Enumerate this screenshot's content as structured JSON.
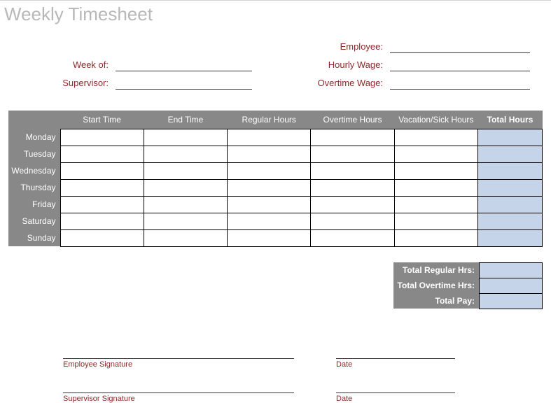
{
  "title": "Weekly Timesheet",
  "fields": {
    "employee": "Employee:",
    "week_of": "Week of:",
    "hourly_wage": "Hourly Wage:",
    "supervisor": "Supervisor:",
    "overtime_wage": "Overtime Wage:"
  },
  "values": {
    "employee": "",
    "week_of": "",
    "hourly_wage": "",
    "supervisor": "",
    "overtime_wage": ""
  },
  "columns": [
    "Start Time",
    "End Time",
    "Regular Hours",
    "Overtime Hours",
    "Vacation/Sick Hours",
    "Total Hours"
  ],
  "days": [
    "Monday",
    "Tuesday",
    "Wednesday",
    "Thursday",
    "Friday",
    "Saturday",
    "Sunday"
  ],
  "cells": {
    "Monday": [
      "",
      "",
      "",
      "",
      "",
      ""
    ],
    "Tuesday": [
      "",
      "",
      "",
      "",
      "",
      ""
    ],
    "Wednesday": [
      "",
      "",
      "",
      "",
      "",
      ""
    ],
    "Thursday": [
      "",
      "",
      "",
      "",
      "",
      ""
    ],
    "Friday": [
      "",
      "",
      "",
      "",
      "",
      ""
    ],
    "Saturday": [
      "",
      "",
      "",
      "",
      "",
      ""
    ],
    "Sunday": [
      "",
      "",
      "",
      "",
      "",
      ""
    ]
  },
  "totals": {
    "regular_label": "Total Regular Hrs:",
    "overtime_label": "Total Overtime Hrs:",
    "pay_label": "Total Pay:",
    "regular": "",
    "overtime": "",
    "pay": ""
  },
  "signatures": {
    "employee": "Employee Signature",
    "supervisor": "Supervisor Signature",
    "date": "Date"
  }
}
